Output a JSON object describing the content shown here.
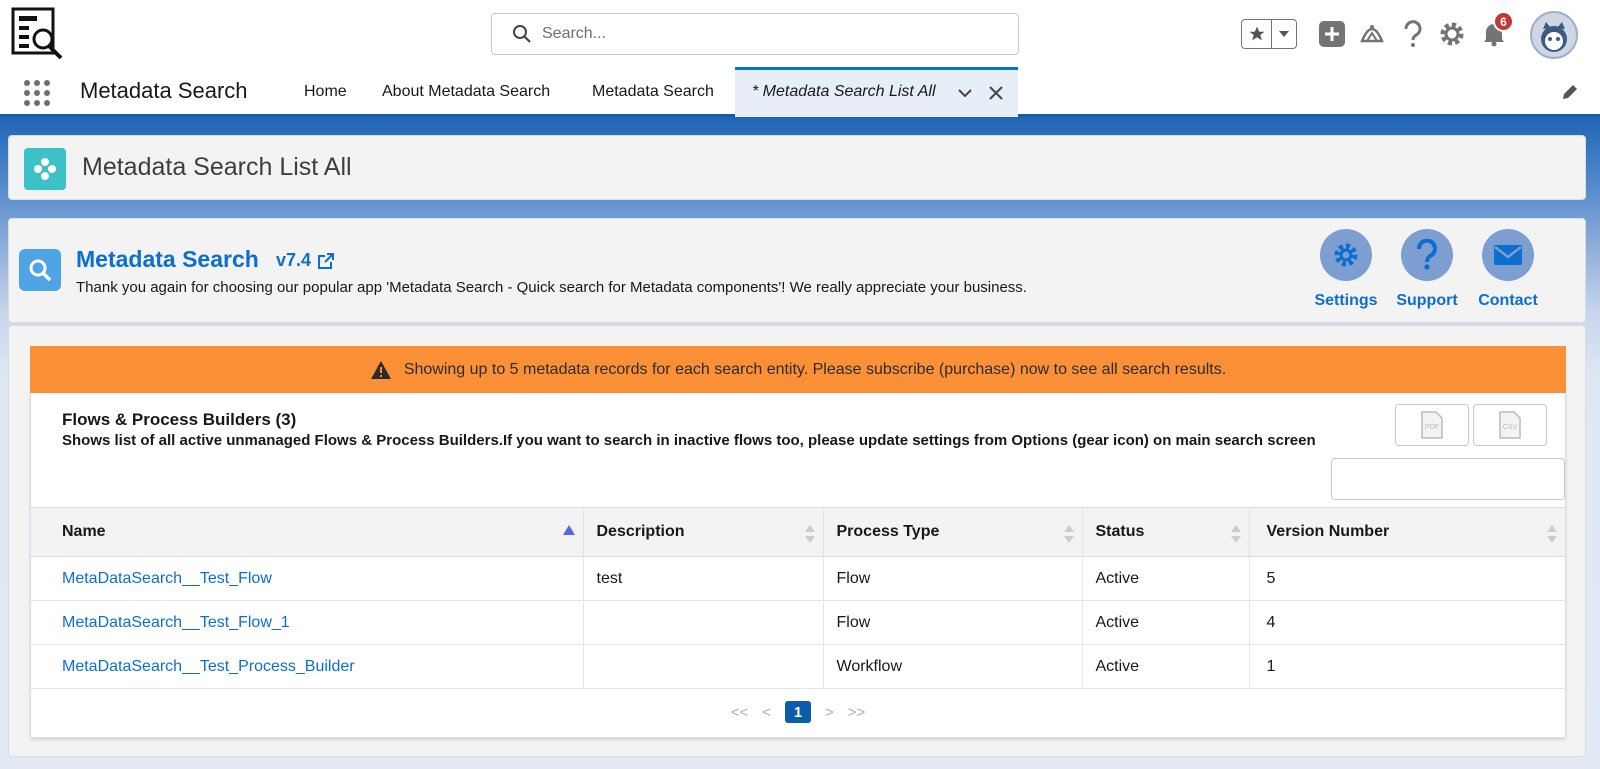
{
  "search": {
    "placeholder": "Search..."
  },
  "header": {
    "notification_count": "6"
  },
  "nav": {
    "app_name": "Metadata Search",
    "items": [
      "Home",
      "About Metadata Search",
      "Metadata Search"
    ],
    "active_tab": "* Metadata Search List All"
  },
  "page": {
    "title": "Metadata Search List All"
  },
  "app": {
    "title": "Metadata Search",
    "version": "v7.4",
    "thanks": "Thank you again for choosing our popular app 'Metadata Search - Quick search for Metadata components'! We really appreciate your business.",
    "actions": [
      "Settings",
      "Support",
      "Contact"
    ]
  },
  "warning": "Showing up to 5 metadata records for each search entity. Please subscribe (purchase) now to see all search results.",
  "section": {
    "title": "Flows & Process Builders (3)",
    "description": "Shows list of all active unmanaged Flows & Process Builders.If you want to search in inactive flows too, please update settings from Options (gear icon) on main search screen",
    "export_pdf_label": "PDF",
    "export_csv_label": "CSV"
  },
  "table": {
    "columns": [
      "Name",
      "Description",
      "Process Type",
      "Status",
      "Version Number"
    ],
    "rows": [
      [
        "MetaDataSearch__Test_Flow",
        "test",
        "Flow",
        "Active",
        "5"
      ],
      [
        "MetaDataSearch__Test_Flow_1",
        "",
        "Flow",
        "Active",
        "4"
      ],
      [
        "MetaDataSearch__Test_Process_Builder",
        "",
        "Workflow",
        "Active",
        "1"
      ]
    ]
  },
  "pager": {
    "first": "<<",
    "prev": "<",
    "current": "1",
    "next": ">",
    "last": ">>"
  },
  "colors": {
    "brand_blue": "#0b6ed0",
    "warning_orange": "#fc9036",
    "badge_red": "#c23934",
    "teal": "#3cc1c7"
  }
}
